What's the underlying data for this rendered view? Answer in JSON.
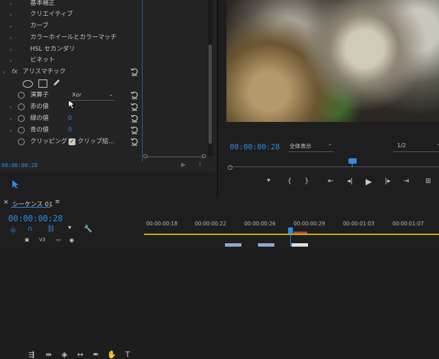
{
  "effects_panel": {
    "items": [
      {
        "label": "基本補正"
      },
      {
        "label": "クリエイティブ"
      },
      {
        "label": "カーブ"
      },
      {
        "label": "カラーホイールとカラーマッチ"
      },
      {
        "label": "HSL セカンダリ"
      },
      {
        "label": "ビネット"
      }
    ],
    "fx_label": "fx",
    "effect_name": "アリスマチック",
    "params": [
      {
        "label": "演算子",
        "value": "Xor"
      },
      {
        "label": "赤の値",
        "value": ""
      },
      {
        "label": "緑の値",
        "value": "0"
      },
      {
        "label": "青の値",
        "value": "0"
      },
      {
        "label": "クリッピング",
        "value": "クリップ結..."
      }
    ],
    "timecode": "00:00:00:28"
  },
  "program": {
    "timecode": "00:00:00:28",
    "zoom": "全体表示",
    "quality": "1/2"
  },
  "timeline": {
    "tab": "シーケンス 01",
    "timecode": "00:00:00:28",
    "track": "V3",
    "ruler": [
      "00:00:00:18",
      "00:00:00:22",
      "00:00:00:26",
      "00:00:00:29",
      "00:00:01:03",
      "00:00:01:07"
    ]
  },
  "colors": {
    "accent": "#2e8ce8"
  }
}
